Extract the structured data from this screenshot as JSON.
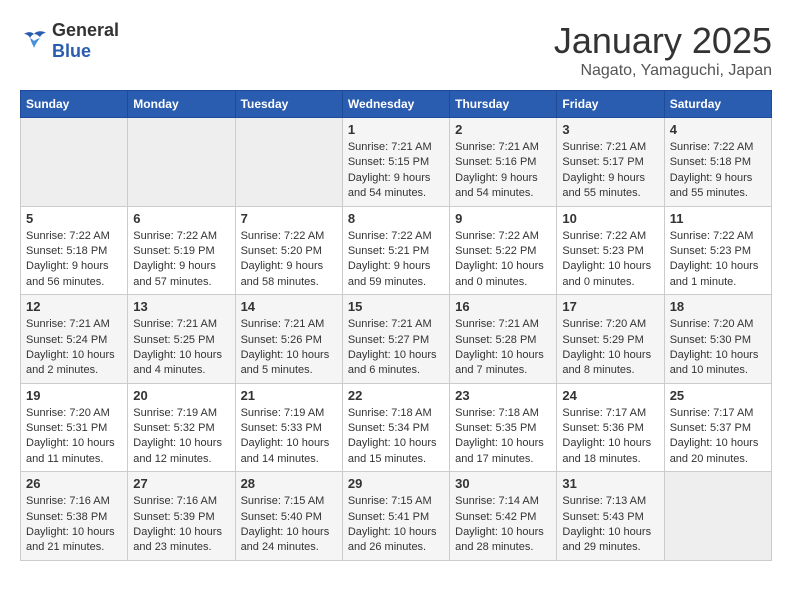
{
  "header": {
    "logo_general": "General",
    "logo_blue": "Blue",
    "title": "January 2025",
    "location": "Nagato, Yamaguchi, Japan"
  },
  "weekdays": [
    "Sunday",
    "Monday",
    "Tuesday",
    "Wednesday",
    "Thursday",
    "Friday",
    "Saturday"
  ],
  "weeks": [
    [
      {
        "day": "",
        "sunrise": "",
        "sunset": "",
        "daylight": "",
        "empty": true
      },
      {
        "day": "",
        "sunrise": "",
        "sunset": "",
        "daylight": "",
        "empty": true
      },
      {
        "day": "",
        "sunrise": "",
        "sunset": "",
        "daylight": "",
        "empty": true
      },
      {
        "day": "1",
        "sunrise": "Sunrise: 7:21 AM",
        "sunset": "Sunset: 5:15 PM",
        "daylight": "Daylight: 9 hours and 54 minutes."
      },
      {
        "day": "2",
        "sunrise": "Sunrise: 7:21 AM",
        "sunset": "Sunset: 5:16 PM",
        "daylight": "Daylight: 9 hours and 54 minutes."
      },
      {
        "day": "3",
        "sunrise": "Sunrise: 7:21 AM",
        "sunset": "Sunset: 5:17 PM",
        "daylight": "Daylight: 9 hours and 55 minutes."
      },
      {
        "day": "4",
        "sunrise": "Sunrise: 7:22 AM",
        "sunset": "Sunset: 5:18 PM",
        "daylight": "Daylight: 9 hours and 55 minutes."
      }
    ],
    [
      {
        "day": "5",
        "sunrise": "Sunrise: 7:22 AM",
        "sunset": "Sunset: 5:18 PM",
        "daylight": "Daylight: 9 hours and 56 minutes."
      },
      {
        "day": "6",
        "sunrise": "Sunrise: 7:22 AM",
        "sunset": "Sunset: 5:19 PM",
        "daylight": "Daylight: 9 hours and 57 minutes."
      },
      {
        "day": "7",
        "sunrise": "Sunrise: 7:22 AM",
        "sunset": "Sunset: 5:20 PM",
        "daylight": "Daylight: 9 hours and 58 minutes."
      },
      {
        "day": "8",
        "sunrise": "Sunrise: 7:22 AM",
        "sunset": "Sunset: 5:21 PM",
        "daylight": "Daylight: 9 hours and 59 minutes."
      },
      {
        "day": "9",
        "sunrise": "Sunrise: 7:22 AM",
        "sunset": "Sunset: 5:22 PM",
        "daylight": "Daylight: 10 hours and 0 minutes."
      },
      {
        "day": "10",
        "sunrise": "Sunrise: 7:22 AM",
        "sunset": "Sunset: 5:23 PM",
        "daylight": "Daylight: 10 hours and 0 minutes."
      },
      {
        "day": "11",
        "sunrise": "Sunrise: 7:22 AM",
        "sunset": "Sunset: 5:23 PM",
        "daylight": "Daylight: 10 hours and 1 minute."
      }
    ],
    [
      {
        "day": "12",
        "sunrise": "Sunrise: 7:21 AM",
        "sunset": "Sunset: 5:24 PM",
        "daylight": "Daylight: 10 hours and 2 minutes."
      },
      {
        "day": "13",
        "sunrise": "Sunrise: 7:21 AM",
        "sunset": "Sunset: 5:25 PM",
        "daylight": "Daylight: 10 hours and 4 minutes."
      },
      {
        "day": "14",
        "sunrise": "Sunrise: 7:21 AM",
        "sunset": "Sunset: 5:26 PM",
        "daylight": "Daylight: 10 hours and 5 minutes."
      },
      {
        "day": "15",
        "sunrise": "Sunrise: 7:21 AM",
        "sunset": "Sunset: 5:27 PM",
        "daylight": "Daylight: 10 hours and 6 minutes."
      },
      {
        "day": "16",
        "sunrise": "Sunrise: 7:21 AM",
        "sunset": "Sunset: 5:28 PM",
        "daylight": "Daylight: 10 hours and 7 minutes."
      },
      {
        "day": "17",
        "sunrise": "Sunrise: 7:20 AM",
        "sunset": "Sunset: 5:29 PM",
        "daylight": "Daylight: 10 hours and 8 minutes."
      },
      {
        "day": "18",
        "sunrise": "Sunrise: 7:20 AM",
        "sunset": "Sunset: 5:30 PM",
        "daylight": "Daylight: 10 hours and 10 minutes."
      }
    ],
    [
      {
        "day": "19",
        "sunrise": "Sunrise: 7:20 AM",
        "sunset": "Sunset: 5:31 PM",
        "daylight": "Daylight: 10 hours and 11 minutes."
      },
      {
        "day": "20",
        "sunrise": "Sunrise: 7:19 AM",
        "sunset": "Sunset: 5:32 PM",
        "daylight": "Daylight: 10 hours and 12 minutes."
      },
      {
        "day": "21",
        "sunrise": "Sunrise: 7:19 AM",
        "sunset": "Sunset: 5:33 PM",
        "daylight": "Daylight: 10 hours and 14 minutes."
      },
      {
        "day": "22",
        "sunrise": "Sunrise: 7:18 AM",
        "sunset": "Sunset: 5:34 PM",
        "daylight": "Daylight: 10 hours and 15 minutes."
      },
      {
        "day": "23",
        "sunrise": "Sunrise: 7:18 AM",
        "sunset": "Sunset: 5:35 PM",
        "daylight": "Daylight: 10 hours and 17 minutes."
      },
      {
        "day": "24",
        "sunrise": "Sunrise: 7:17 AM",
        "sunset": "Sunset: 5:36 PM",
        "daylight": "Daylight: 10 hours and 18 minutes."
      },
      {
        "day": "25",
        "sunrise": "Sunrise: 7:17 AM",
        "sunset": "Sunset: 5:37 PM",
        "daylight": "Daylight: 10 hours and 20 minutes."
      }
    ],
    [
      {
        "day": "26",
        "sunrise": "Sunrise: 7:16 AM",
        "sunset": "Sunset: 5:38 PM",
        "daylight": "Daylight: 10 hours and 21 minutes."
      },
      {
        "day": "27",
        "sunrise": "Sunrise: 7:16 AM",
        "sunset": "Sunset: 5:39 PM",
        "daylight": "Daylight: 10 hours and 23 minutes."
      },
      {
        "day": "28",
        "sunrise": "Sunrise: 7:15 AM",
        "sunset": "Sunset: 5:40 PM",
        "daylight": "Daylight: 10 hours and 24 minutes."
      },
      {
        "day": "29",
        "sunrise": "Sunrise: 7:15 AM",
        "sunset": "Sunset: 5:41 PM",
        "daylight": "Daylight: 10 hours and 26 minutes."
      },
      {
        "day": "30",
        "sunrise": "Sunrise: 7:14 AM",
        "sunset": "Sunset: 5:42 PM",
        "daylight": "Daylight: 10 hours and 28 minutes."
      },
      {
        "day": "31",
        "sunrise": "Sunrise: 7:13 AM",
        "sunset": "Sunset: 5:43 PM",
        "daylight": "Daylight: 10 hours and 29 minutes."
      },
      {
        "day": "",
        "sunrise": "",
        "sunset": "",
        "daylight": "",
        "empty": true
      }
    ]
  ]
}
